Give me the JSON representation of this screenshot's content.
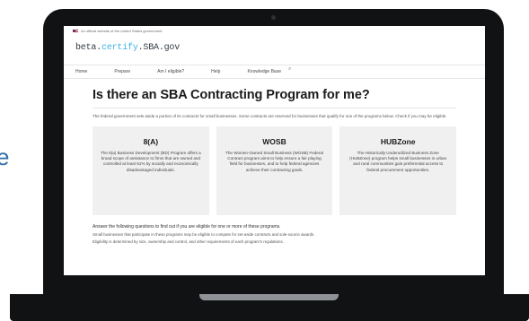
{
  "edge_text": "e",
  "browser": {
    "gov_banner": "An official website of the United States government",
    "logo": {
      "prefix": "beta.",
      "accent": "certify",
      "suffix": ".SBA.gov"
    },
    "nav": [
      "Home",
      "Prepare",
      "Am I eligible?",
      "Help",
      "Knowledge Base"
    ],
    "page": {
      "title": "Is there an SBA Contracting Program for me?",
      "intro": "The federal government sets aside a portion of its contracts for small businesses. Some contracts are reserved for businesses that qualify for one of the programs below. Check if you may be eligible.",
      "cards": [
        {
          "title": "8(A)",
          "desc": "The 8(a) Business Development (BD) Program offers a broad scope of assistance to firms that are owned and controlled at least 51% by socially and economically disadvantaged individuals."
        },
        {
          "title": "WOSB",
          "desc": "The Women-Owned Small Business (WOSB) Federal Contract program aims to help ensure a fair playing field for businesses, and to help federal agencies achieve their contracting goals."
        },
        {
          "title": "HUBZone",
          "desc": "The Historically Underutilized Business Zone (HUBZone) program helps small businesses in urban and rural communities gain preferential access to federal procurement opportunities."
        }
      ],
      "lower_heading": "Answer the following questions to find out if you are eligible for one or more of these programs.",
      "lower_body": [
        "Small businesses that participate in these programs may be eligible to compete for set-aside contracts and sole-source awards.",
        "Eligibility is determined by size, ownership and control, and other requirements of each program's regulations."
      ]
    }
  }
}
